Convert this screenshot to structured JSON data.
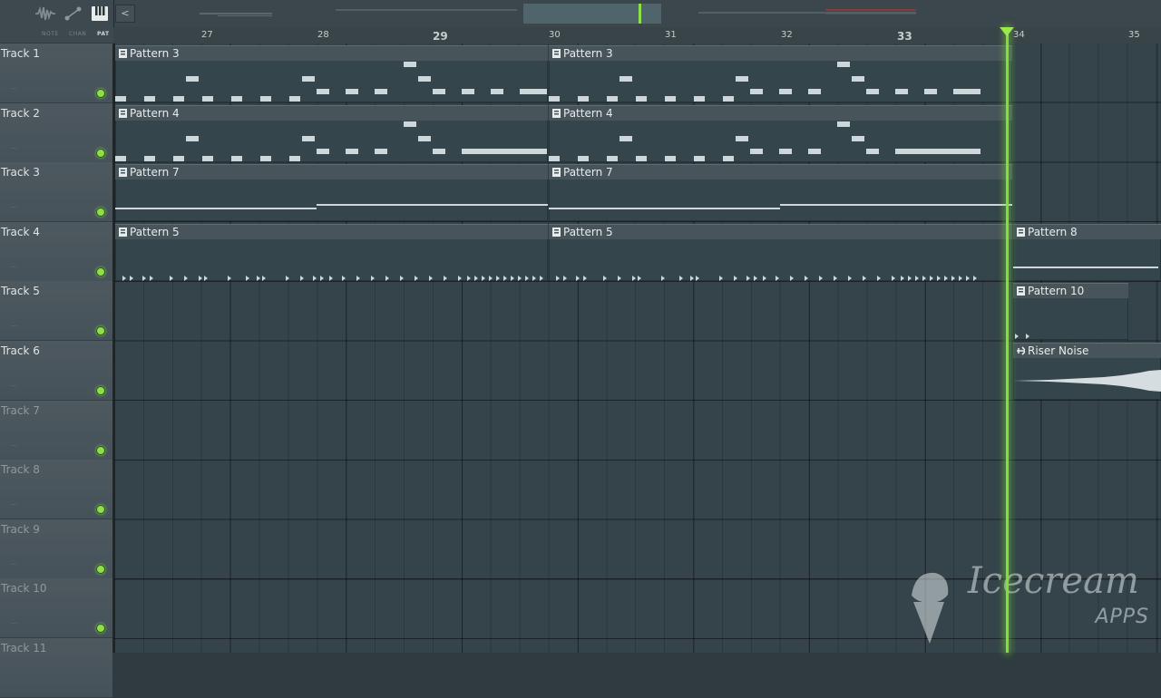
{
  "toolbar": {
    "modes": [
      {
        "label": "NOTE",
        "icon": "waveform-icon",
        "active": false
      },
      {
        "label": "CHAN",
        "icon": "slide-icon",
        "active": false
      },
      {
        "label": "PAT",
        "icon": "piano-keys-icon",
        "active": true
      }
    ],
    "scroll_left_glyph": "<"
  },
  "ruler": {
    "bars": [
      "27",
      "28",
      "29",
      "30",
      "31",
      "32",
      "33",
      "34",
      "35"
    ],
    "bold_bars": [
      "29",
      "33"
    ]
  },
  "tracks": [
    {
      "name": "Track 1",
      "active": true
    },
    {
      "name": "Track 2",
      "active": true
    },
    {
      "name": "Track 3",
      "active": true
    },
    {
      "name": "Track 4",
      "active": true
    },
    {
      "name": "Track 5",
      "active": true
    },
    {
      "name": "Track 6",
      "active": true
    },
    {
      "name": "Track 7",
      "active": false
    },
    {
      "name": "Track 8",
      "active": false
    },
    {
      "name": "Track 9",
      "active": false
    },
    {
      "name": "Track 10",
      "active": false
    },
    {
      "name": "Track 11",
      "active": false
    }
  ],
  "track_dots": "...",
  "clips": {
    "t1a": "Pattern 3",
    "t1b": "Pattern 3",
    "t2a": "Pattern 4",
    "t2b": "Pattern 4",
    "t3a": "Pattern 7",
    "t3b": "Pattern 7",
    "t4a": "Pattern 5",
    "t4b": "Pattern 5",
    "t4c": "Pattern 8",
    "t5c": "Pattern 10",
    "t6c": "Riser Noise"
  },
  "playhead_bar": 34,
  "watermark": {
    "title": "Icecream",
    "subtitle": "APPS"
  },
  "colors": {
    "playhead": "#7fe039",
    "mute_led": "#8ee04a",
    "note": "#cdd6d9"
  }
}
